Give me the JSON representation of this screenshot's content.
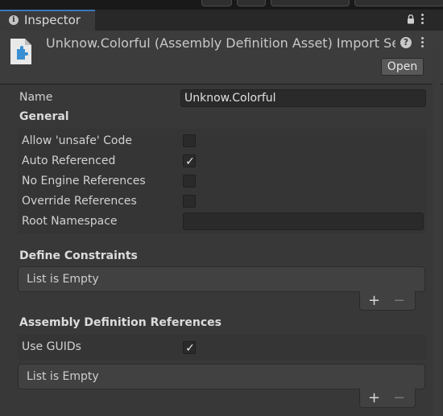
{
  "tab": {
    "label": "Inspector"
  },
  "header": {
    "title": "Unknow.Colorful (Assembly Definition Asset) Import Se",
    "help_glyph": "?",
    "open_label": "Open"
  },
  "name_row": {
    "label": "Name",
    "value": "Unknow.Colorful"
  },
  "general": {
    "heading": "General",
    "rows": [
      {
        "label": "Allow 'unsafe' Code",
        "checked": false
      },
      {
        "label": "Auto Referenced",
        "checked": true
      },
      {
        "label": "No Engine References",
        "checked": false
      },
      {
        "label": "Override References",
        "checked": false
      }
    ],
    "root_namespace": {
      "label": "Root Namespace",
      "value": ""
    }
  },
  "define_constraints": {
    "heading": "Define Constraints",
    "empty_text": "List is Empty",
    "plus": "+",
    "minus": "−"
  },
  "assembly_refs": {
    "heading": "Assembly Definition References",
    "use_guids": {
      "label": "Use GUIDs",
      "checked": true
    },
    "empty_text": "List is Empty",
    "plus": "+",
    "minus": "−"
  },
  "check_glyph": "✓",
  "icons": [
    "info-icon",
    "lock-icon",
    "kebab-menu-icon",
    "asset-file-icon",
    "help-icon",
    "checkmark-icon",
    "plus-icon",
    "minus-icon"
  ],
  "colors": {
    "accent_tab": "#3a79bb",
    "panel": "#383838",
    "field": "#2a2a2a"
  }
}
